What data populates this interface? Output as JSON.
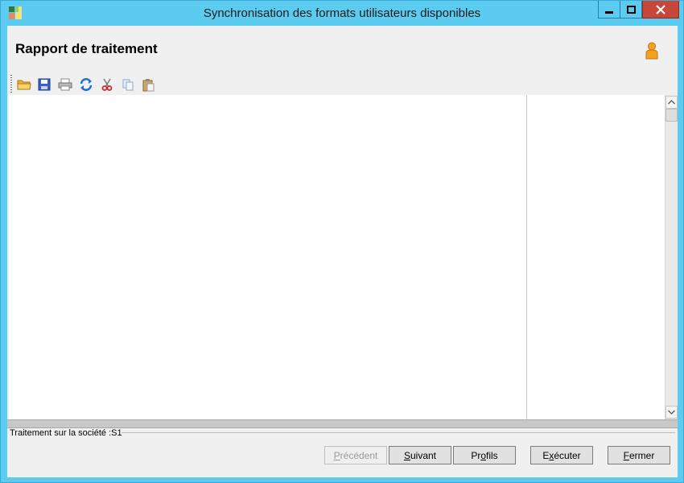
{
  "window": {
    "title": "Synchronisation des formats utilisateurs disponibles"
  },
  "header": {
    "title": "Rapport de traitement"
  },
  "toolbar": {
    "icons": [
      "open-folder-icon",
      "save-icon",
      "print-icon",
      "refresh-icon",
      "cut-icon",
      "copy-icon",
      "paste-icon"
    ]
  },
  "status": {
    "text": "Traitement sur la société :S1"
  },
  "buttons": {
    "previous": {
      "pre": "",
      "key": "P",
      "post": "récédent",
      "disabled": true
    },
    "next": {
      "pre": "",
      "key": "S",
      "post": "uivant"
    },
    "profiles": {
      "pre": "Pr",
      "key": "o",
      "post": "fils"
    },
    "execute": {
      "pre": "E",
      "key": "x",
      "post": "écuter"
    },
    "close": {
      "pre": "",
      "key": "F",
      "post": "ermer"
    }
  },
  "colors": {
    "title_bar": "#5ccbf0",
    "close_button": "#c7483b",
    "client_bg": "#f0f0f0"
  }
}
